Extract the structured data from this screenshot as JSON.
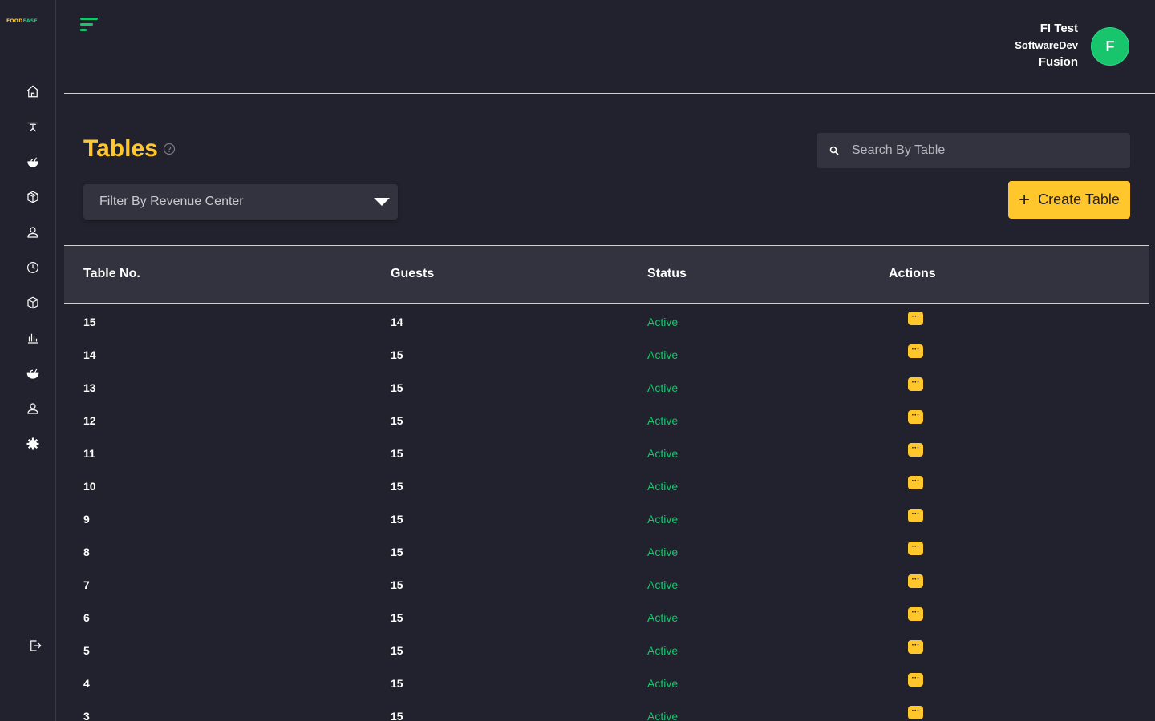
{
  "brand": {
    "part1": "FOOD",
    "part2": "EASE"
  },
  "sidebar": {
    "items": [
      {
        "icon": "home-icon"
      },
      {
        "icon": "table-icon"
      },
      {
        "icon": "food-icon"
      },
      {
        "icon": "box-icon"
      },
      {
        "icon": "user-icon"
      },
      {
        "icon": "clock-icon"
      },
      {
        "icon": "cube-icon"
      },
      {
        "icon": "bar-chart-icon"
      },
      {
        "icon": "dish-icon"
      },
      {
        "icon": "person-icon"
      },
      {
        "icon": "gear-icon"
      }
    ],
    "logout_icon": "logout-icon"
  },
  "header": {
    "user_line1": "FI Test",
    "user_line2": "SoftwareDev",
    "user_line3": "Fusion",
    "avatar_initial": "F"
  },
  "page": {
    "title": "Tables",
    "search_placeholder": "Search By Table",
    "filter_label": "Filter By Revenue Center",
    "create_label": "Create Table",
    "create_icon": "+"
  },
  "table": {
    "headers": [
      "Table No.",
      "Guests",
      "Status",
      "Actions"
    ],
    "action_label": "···",
    "rows": [
      {
        "table_no": "15",
        "guests": "14",
        "status": "Active"
      },
      {
        "table_no": "14",
        "guests": "15",
        "status": "Active"
      },
      {
        "table_no": "13",
        "guests": "15",
        "status": "Active"
      },
      {
        "table_no": "12",
        "guests": "15",
        "status": "Active"
      },
      {
        "table_no": "11",
        "guests": "15",
        "status": "Active"
      },
      {
        "table_no": "10",
        "guests": "15",
        "status": "Active"
      },
      {
        "table_no": "9",
        "guests": "15",
        "status": "Active"
      },
      {
        "table_no": "8",
        "guests": "15",
        "status": "Active"
      },
      {
        "table_no": "7",
        "guests": "15",
        "status": "Active"
      },
      {
        "table_no": "6",
        "guests": "15",
        "status": "Active"
      },
      {
        "table_no": "5",
        "guests": "15",
        "status": "Active"
      },
      {
        "table_no": "4",
        "guests": "15",
        "status": "Active"
      },
      {
        "table_no": "3",
        "guests": "15",
        "status": "Active"
      }
    ]
  },
  "colors": {
    "background": "#22222e",
    "panel": "#33333f",
    "accent_yellow": "#ffc72c",
    "accent_green": "#18c46c"
  }
}
